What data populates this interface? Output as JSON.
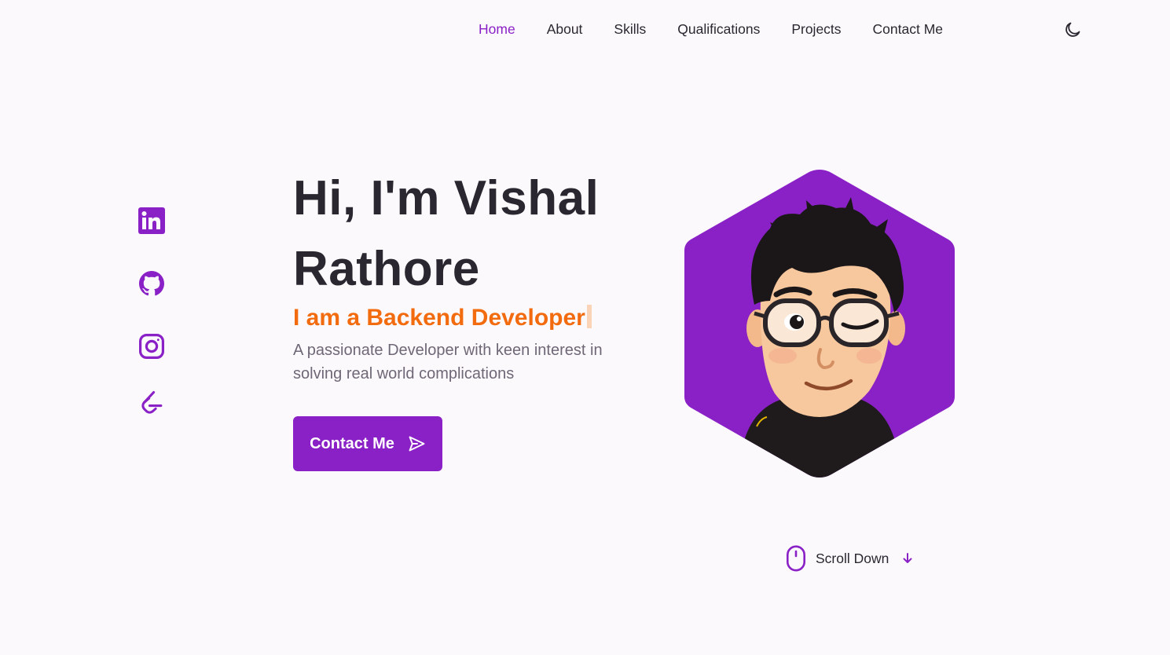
{
  "nav": {
    "items": [
      {
        "label": "Home",
        "active": true
      },
      {
        "label": "About",
        "active": false
      },
      {
        "label": "Skills",
        "active": false
      },
      {
        "label": "Qualifications",
        "active": false
      },
      {
        "label": "Projects",
        "active": false
      },
      {
        "label": "Contact Me",
        "active": false
      }
    ],
    "theme_toggle_icon": "moon-icon"
  },
  "social": {
    "icons": [
      "linkedin-icon",
      "github-icon",
      "instagram-icon",
      "leetcode-icon"
    ]
  },
  "hero": {
    "title": "Hi, I'm Vishal Rathore",
    "subtitle": "I am a Backend Developer",
    "description": "A passionate Developer with keen interest in solving real world complications",
    "button_label": "Contact Me",
    "button_icon": "send-icon",
    "avatar_icon": "avatar-icon"
  },
  "scroll": {
    "label": "Scroll Down",
    "mouse_icon": "mouse-icon",
    "arrow_icon": "arrow-down-icon"
  },
  "colors": {
    "accent": "#8a21c6",
    "subtitle": "#f26b0f",
    "background": "#fcf9fd",
    "text": "#2b2730",
    "muted": "#6e6776"
  }
}
